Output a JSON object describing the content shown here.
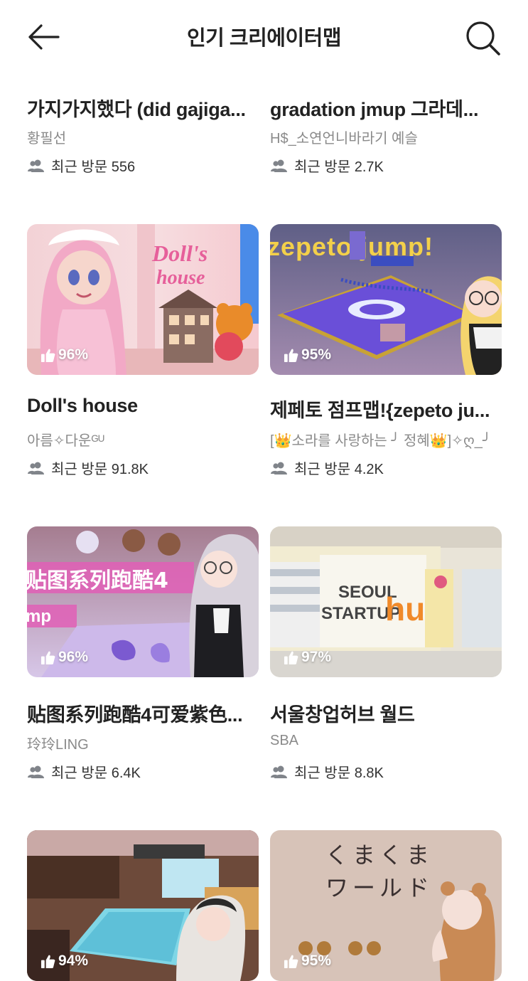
{
  "header": {
    "title": "인기 크리에이터맵"
  },
  "colors": {
    "text": "#222222",
    "muted": "#8a8a8a",
    "icon": "#80848a"
  },
  "cards": [
    {
      "name": "가지가지했다 (did gajiga...",
      "creator": "황필선",
      "visits": "최근 방문 556"
    },
    {
      "name": "gradation jmup 그라데...",
      "creator": "H$_소연언니바라기 예슬",
      "visits": "최근 방문 2.7K"
    },
    {
      "name": "Doll's house",
      "creator": "아름✧다운ᴳᵁ",
      "visits": "최근 방문 91.8K",
      "like": "96%",
      "thumb_text": [
        "Doll's",
        "house"
      ]
    },
    {
      "name": "제페토 점프맵!{zepeto ju...",
      "creator": "[👑소라를 사랑하는 ╯ 정혜👑]✧ღ_╯",
      "visits": "최근 방문 4.2K",
      "like": "95%",
      "thumb_text": [
        "zepeto jump!"
      ]
    },
    {
      "name": "贴图系列跑酷4可爱紫色...",
      "creator": "玲玲LING",
      "visits": "최근 방문 6.4K",
      "like": "96%",
      "thumb_text": [
        "贴图系列跑酷4",
        "mp"
      ]
    },
    {
      "name": "서울창업허브 월드",
      "creator": "SBA",
      "visits": "최근 방문 8.8K",
      "like": "97%",
      "thumb_text": [
        "SEOUL",
        "STARTUP",
        "hub"
      ]
    },
    {
      "like": "94%"
    },
    {
      "like": "95%",
      "thumb_text": [
        "くまくま",
        "ワールド"
      ]
    }
  ]
}
